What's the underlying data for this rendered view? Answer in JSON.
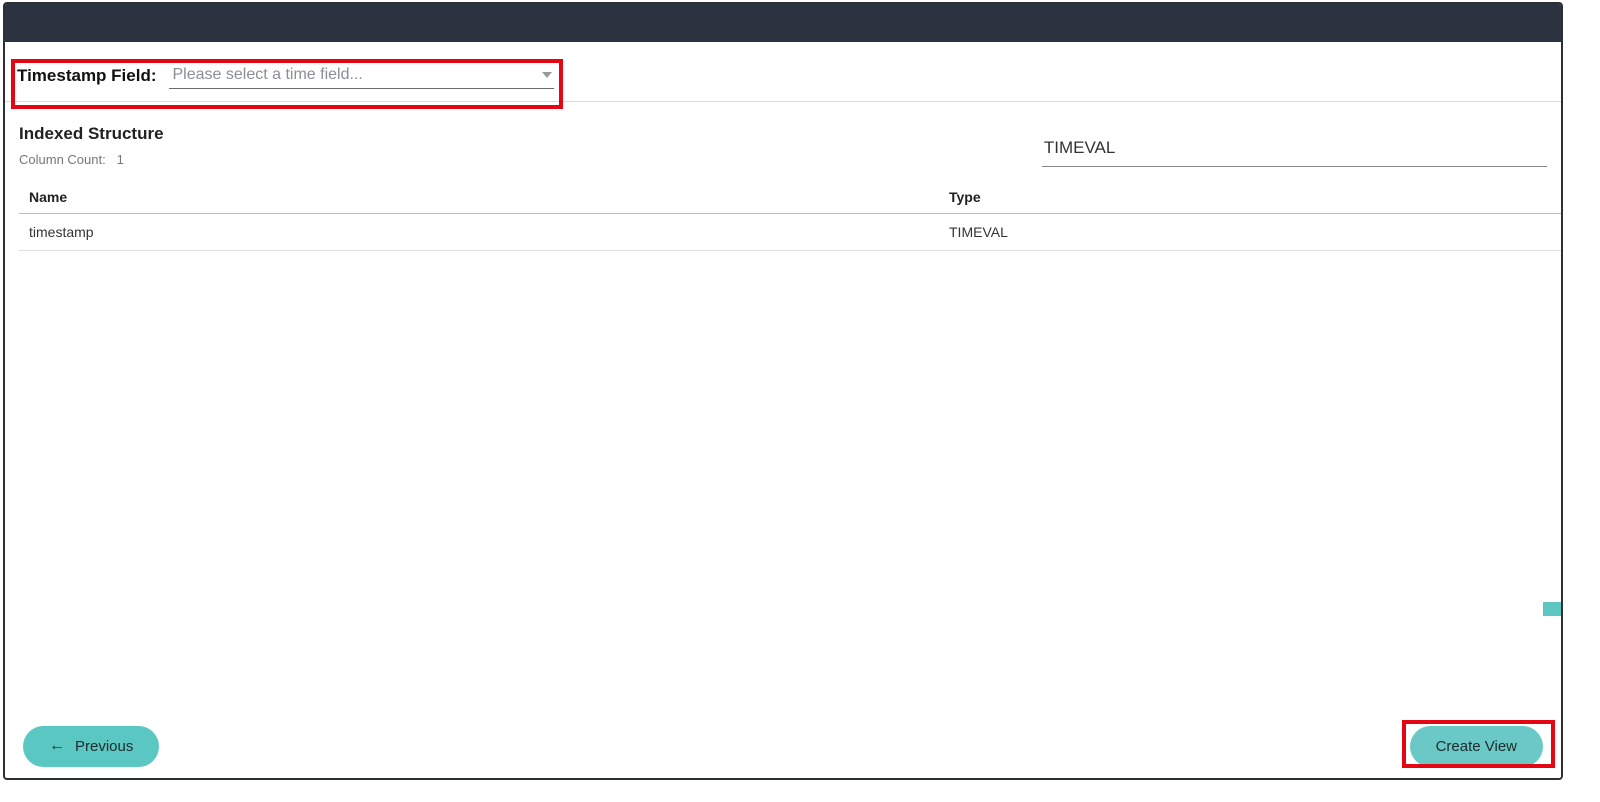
{
  "field": {
    "label": "Timestamp Field:",
    "placeholder": "Please select a time field..."
  },
  "structure": {
    "title": "Indexed Structure",
    "count_label": "Column Count:",
    "count_value": "1"
  },
  "right_value": "TIMEVAL",
  "table": {
    "headers": {
      "name": "Name",
      "type": "Type"
    },
    "rows": [
      {
        "name": "timestamp",
        "type": "TIMEVAL"
      }
    ]
  },
  "buttons": {
    "previous": "Previous",
    "create": "Create View"
  }
}
